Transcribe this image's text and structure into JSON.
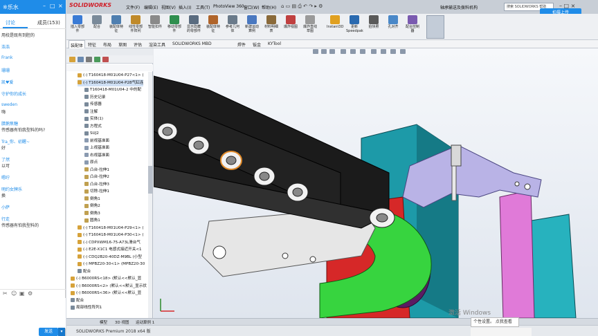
{
  "chat": {
    "window_label": "※乐水",
    "tabs": [
      "讨论",
      "成员(153)"
    ],
    "messages": [
      {
        "name": "",
        "body": "用校是既有到腔的"
      },
      {
        "name": "浩浩",
        "body": ""
      },
      {
        "name": "Frank",
        "body": ""
      },
      {
        "name": "珊珊",
        "body": ""
      },
      {
        "name": "凯♥爱",
        "body": ""
      },
      {
        "name": "守护你的成长",
        "body": ""
      },
      {
        "name": "sweden",
        "body": "嗨"
      },
      {
        "name": "腊鹅焦糖",
        "body": "传感器有怕我型料的吗?"
      },
      {
        "name": "Tra_你、初醒~",
        "body": "好"
      },
      {
        "name": "了然",
        "body": "以可"
      },
      {
        "name": "嗯咛",
        "body": ""
      },
      {
        "name": "明约女牌乐",
        "body": "换"
      },
      {
        "name": "小萨",
        "body": ""
      },
      {
        "name": "行走",
        "body": "传感器有怕我型料的"
      }
    ],
    "send_label": "发送"
  },
  "sw": {
    "brand": "SOLIDWORKS",
    "menus": [
      "文件(F)",
      "编辑(E)",
      "视图(V)",
      "插入(I)",
      "工具(T)",
      "PhotoView 360",
      "窗口(W)",
      "帮助(H)"
    ],
    "doc_title": "轴承输送及拨料机构",
    "search_placeholder": "搜索 SOLIDWORKS 帮助",
    "upload_label": "拍摄上传",
    "ribbon": [
      {
        "label": "插入零部件",
        "color": "#3a7bd5"
      },
      {
        "label": "配合",
        "color": "#7a8a9a"
      },
      {
        "label": "装配体特征",
        "color": "#4f7fb0"
      },
      {
        "label": "线性零部件阵列",
        "color": "#c08a2a"
      },
      {
        "label": "智能扣件",
        "color": "#8a8a8a"
      },
      {
        "label": "移动零部件",
        "color": "#2f8f4f"
      },
      {
        "label": "显示隐藏的零部件",
        "color": "#5a6c80"
      },
      {
        "label": "装配体特征",
        "color": "#b0642a"
      },
      {
        "label": "参考几何体",
        "color": "#6a7a8a"
      },
      {
        "label": "新建运动算例",
        "color": "#4a78c0"
      },
      {
        "label": "材料明细表",
        "color": "#8a6a3a"
      },
      {
        "label": "爆炸视图",
        "color": "#c04040"
      },
      {
        "label": "爆炸直线草图",
        "color": "#9a9a9a"
      },
      {
        "label": "Instant3D",
        "color": "#e0a020"
      },
      {
        "label": "更新 Speedpak",
        "color": "#2a6ab0"
      },
      {
        "label": "拍快照",
        "color": "#5a5a5a"
      },
      {
        "label": "孔对齐",
        "color": "#4a88c8"
      },
      {
        "label": "配合控制器",
        "color": "#7a5ab0"
      }
    ],
    "command_tabs": [
      "装配体",
      "特征",
      "布局",
      "草图",
      "评估",
      "渲染工具",
      "SOLIDWORKS MBD",
      "焊件",
      "钣金",
      "KYTool"
    ],
    "active_command_tab": "装配体",
    "tree": [
      {
        "text": "(-) T160418-M01U04-P27<1> (",
        "indent": 1,
        "color": "#d6a23a"
      },
      {
        "text": "(-) T160418-M01U04-P28气缸连",
        "indent": 1,
        "color": "#d6a23a"
      },
      {
        "text": "T160418-M01U04-2 中的配",
        "indent": 2,
        "color": "#7a8a9a"
      },
      {
        "text": "历史记录",
        "indent": 2,
        "color": "#7a8a9a"
      },
      {
        "text": "传感器",
        "indent": 2,
        "color": "#7a8a9a"
      },
      {
        "text": "注解",
        "indent": 2,
        "color": "#7a8a9a"
      },
      {
        "text": "实体(1)",
        "indent": 2,
        "color": "#7a8a9a"
      },
      {
        "text": "方程式",
        "indent": 2,
        "color": "#7a8a9a"
      },
      {
        "text": "SUJ2",
        "indent": 2,
        "color": "#7a8a9a"
      },
      {
        "text": "前视基准面",
        "indent": 2,
        "color": "#8a9ab0"
      },
      {
        "text": "上视基准面",
        "indent": 2,
        "color": "#8a9ab0"
      },
      {
        "text": "右视基准面",
        "indent": 2,
        "color": "#8a9ab0"
      },
      {
        "text": "原点",
        "indent": 2,
        "color": "#8a9ab0"
      },
      {
        "text": "凸台-拉伸1",
        "indent": 2,
        "color": "#c0a050"
      },
      {
        "text": "凸台-拉伸2",
        "indent": 2,
        "color": "#c0a050"
      },
      {
        "text": "凸台-拉伸3",
        "indent": 2,
        "color": "#c0a050"
      },
      {
        "text": "切除-拉伸1",
        "indent": 2,
        "color": "#c0a050"
      },
      {
        "text": "倒角1",
        "indent": 2,
        "color": "#c0a050"
      },
      {
        "text": "倒角2",
        "indent": 2,
        "color": "#c0a050"
      },
      {
        "text": "倒角3",
        "indent": 2,
        "color": "#c0a050"
      },
      {
        "text": "圆角1",
        "indent": 2,
        "color": "#c0a050"
      },
      {
        "text": "(-) T160418-M01U04-P29<1> (",
        "indent": 1,
        "color": "#d6a23a"
      },
      {
        "text": "(-) T160418-M01U04-P30<1> (",
        "indent": 1,
        "color": "#d6a23a"
      },
      {
        "text": "(-) CDPXWM16-75-A73L滑台气",
        "indent": 1,
        "color": "#d6a23a"
      },
      {
        "text": "(-) E2E-X1C1 电感式接近开关<1",
        "indent": 1,
        "color": "#d6a23a"
      },
      {
        "text": "(-) CDQ2B20-40DZ-M9BL (小型",
        "indent": 1,
        "color": "#d6a23a"
      },
      {
        "text": "(-) MPBZ20-30<1> (MPBZ20-30",
        "indent": 1,
        "color": "#d6a23a"
      },
      {
        "text": "配合",
        "indent": 1,
        "color": "#7a8a9a"
      },
      {
        "text": "(-) B6000RS<18> (默认<<默认_显",
        "indent": 0,
        "color": "#d6a23a"
      },
      {
        "text": "(-) B6000RS<2> (默认<<默认_显示状",
        "indent": 0,
        "color": "#d6a23a"
      },
      {
        "text": "(-) B6000RS<36> (默认<<默认_显",
        "indent": 0,
        "color": "#d6a23a"
      },
      {
        "text": "配合",
        "indent": 0,
        "color": "#7a8a9a"
      },
      {
        "text": "局部线性阵列1",
        "indent": 0,
        "color": "#7a8a9a"
      }
    ],
    "selected_node": 1,
    "bottom_tabs": [
      "模型",
      "3D 视图",
      "运动算例 1"
    ],
    "status": "SOLIDWORKS Premium 2018 x64 版",
    "watermark": "激活 Windows",
    "watermark_sub": "个性设置。",
    "popup": "个性设置。 点我查看"
  }
}
